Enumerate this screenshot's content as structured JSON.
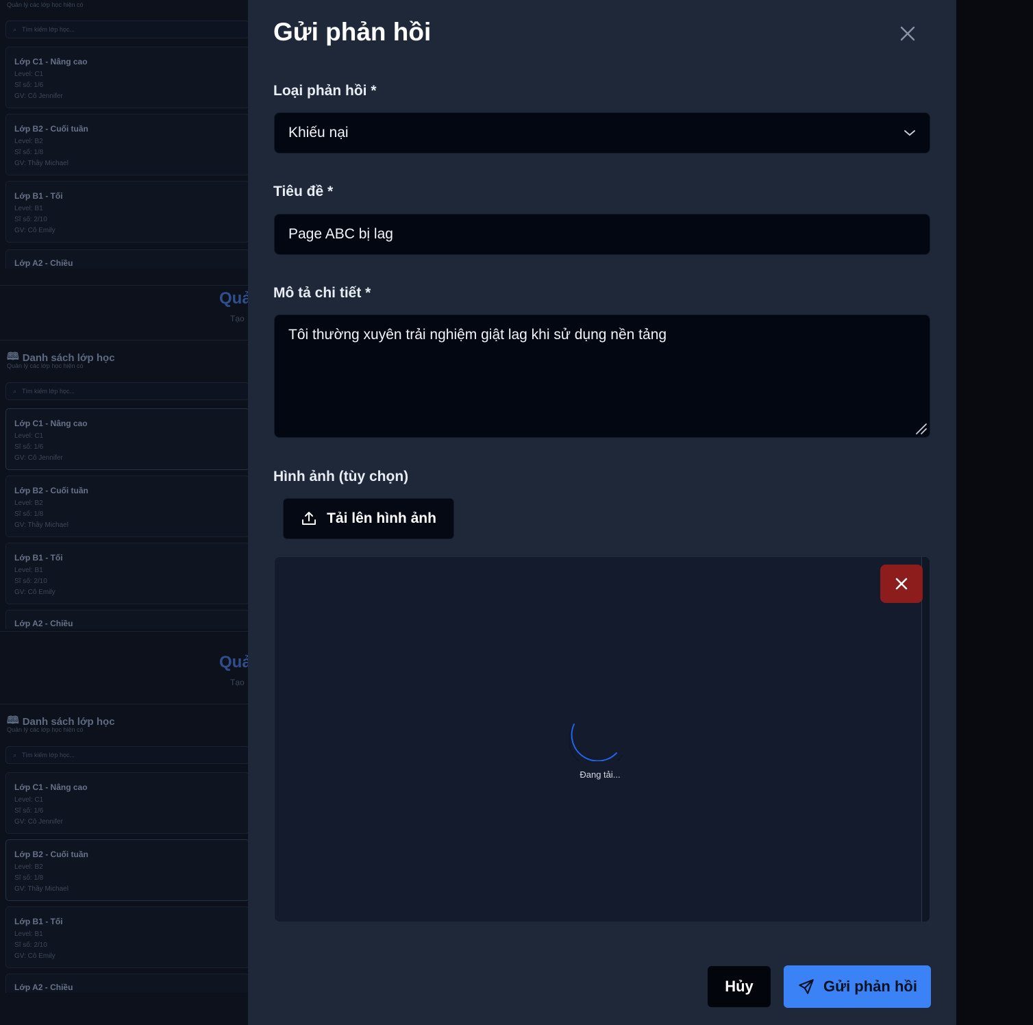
{
  "background": {
    "section_title": "Danh sách lớp học",
    "section_subtitle": "Quản lý các lớp học hiện có",
    "search_placeholder": "Tìm kiếm lớp học...",
    "partial_heading": "Quả",
    "partial_sub": "Tạo",
    "classes": [
      {
        "title": "Lớp C1 - Nâng cao",
        "level": "Level: C1",
        "size": "Sĩ số: 1/6",
        "teacher": "GV: Cô Jennifer"
      },
      {
        "title": "Lớp B2 - Cuối tuần",
        "level": "Level: B2",
        "size": "Sĩ số: 1/8",
        "teacher": "GV: Thầy Michael"
      },
      {
        "title": "Lớp B1 - Tối",
        "level": "Level: B1",
        "size": "Sĩ số: 2/10",
        "teacher": "GV: Cô Emily"
      },
      {
        "title": "Lớp A2 - Chiều"
      }
    ]
  },
  "modal": {
    "title": "Gửi phản hồi",
    "type_label": "Loại phản hồi *",
    "type_value": "Khiếu nại",
    "subject_label": "Tiêu đề *",
    "subject_value": "Page ABC bị lag",
    "description_label": "Mô tả chi tiết *",
    "description_value": "Tôi thường xuyên trải nghiệm giật lag khi sử dụng nền tảng",
    "image_label": "Hình ảnh (tùy chọn)",
    "upload_label": "Tải lên hình ảnh",
    "loading_text": "Đang tải...",
    "cancel_label": "Hủy",
    "submit_label": "Gửi phản hồi"
  },
  "colors": {
    "accent": "#3b82f6",
    "danger": "#8d1d1d",
    "panel": "#1e2838",
    "field": "#030712"
  }
}
